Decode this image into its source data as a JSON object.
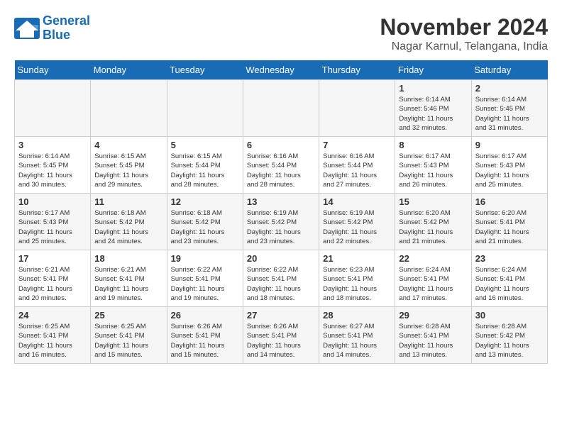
{
  "header": {
    "logo_line1": "General",
    "logo_line2": "Blue",
    "month": "November 2024",
    "location": "Nagar Karnul, Telangana, India"
  },
  "weekdays": [
    "Sunday",
    "Monday",
    "Tuesday",
    "Wednesday",
    "Thursday",
    "Friday",
    "Saturday"
  ],
  "weeks": [
    [
      {
        "day": "",
        "info": ""
      },
      {
        "day": "",
        "info": ""
      },
      {
        "day": "",
        "info": ""
      },
      {
        "day": "",
        "info": ""
      },
      {
        "day": "",
        "info": ""
      },
      {
        "day": "1",
        "info": "Sunrise: 6:14 AM\nSunset: 5:46 PM\nDaylight: 11 hours\nand 32 minutes."
      },
      {
        "day": "2",
        "info": "Sunrise: 6:14 AM\nSunset: 5:45 PM\nDaylight: 11 hours\nand 31 minutes."
      }
    ],
    [
      {
        "day": "3",
        "info": "Sunrise: 6:14 AM\nSunset: 5:45 PM\nDaylight: 11 hours\nand 30 minutes."
      },
      {
        "day": "4",
        "info": "Sunrise: 6:15 AM\nSunset: 5:45 PM\nDaylight: 11 hours\nand 29 minutes."
      },
      {
        "day": "5",
        "info": "Sunrise: 6:15 AM\nSunset: 5:44 PM\nDaylight: 11 hours\nand 28 minutes."
      },
      {
        "day": "6",
        "info": "Sunrise: 6:16 AM\nSunset: 5:44 PM\nDaylight: 11 hours\nand 28 minutes."
      },
      {
        "day": "7",
        "info": "Sunrise: 6:16 AM\nSunset: 5:44 PM\nDaylight: 11 hours\nand 27 minutes."
      },
      {
        "day": "8",
        "info": "Sunrise: 6:17 AM\nSunset: 5:43 PM\nDaylight: 11 hours\nand 26 minutes."
      },
      {
        "day": "9",
        "info": "Sunrise: 6:17 AM\nSunset: 5:43 PM\nDaylight: 11 hours\nand 25 minutes."
      }
    ],
    [
      {
        "day": "10",
        "info": "Sunrise: 6:17 AM\nSunset: 5:43 PM\nDaylight: 11 hours\nand 25 minutes."
      },
      {
        "day": "11",
        "info": "Sunrise: 6:18 AM\nSunset: 5:42 PM\nDaylight: 11 hours\nand 24 minutes."
      },
      {
        "day": "12",
        "info": "Sunrise: 6:18 AM\nSunset: 5:42 PM\nDaylight: 11 hours\nand 23 minutes."
      },
      {
        "day": "13",
        "info": "Sunrise: 6:19 AM\nSunset: 5:42 PM\nDaylight: 11 hours\nand 23 minutes."
      },
      {
        "day": "14",
        "info": "Sunrise: 6:19 AM\nSunset: 5:42 PM\nDaylight: 11 hours\nand 22 minutes."
      },
      {
        "day": "15",
        "info": "Sunrise: 6:20 AM\nSunset: 5:42 PM\nDaylight: 11 hours\nand 21 minutes."
      },
      {
        "day": "16",
        "info": "Sunrise: 6:20 AM\nSunset: 5:41 PM\nDaylight: 11 hours\nand 21 minutes."
      }
    ],
    [
      {
        "day": "17",
        "info": "Sunrise: 6:21 AM\nSunset: 5:41 PM\nDaylight: 11 hours\nand 20 minutes."
      },
      {
        "day": "18",
        "info": "Sunrise: 6:21 AM\nSunset: 5:41 PM\nDaylight: 11 hours\nand 19 minutes."
      },
      {
        "day": "19",
        "info": "Sunrise: 6:22 AM\nSunset: 5:41 PM\nDaylight: 11 hours\nand 19 minutes."
      },
      {
        "day": "20",
        "info": "Sunrise: 6:22 AM\nSunset: 5:41 PM\nDaylight: 11 hours\nand 18 minutes."
      },
      {
        "day": "21",
        "info": "Sunrise: 6:23 AM\nSunset: 5:41 PM\nDaylight: 11 hours\nand 18 minutes."
      },
      {
        "day": "22",
        "info": "Sunrise: 6:24 AM\nSunset: 5:41 PM\nDaylight: 11 hours\nand 17 minutes."
      },
      {
        "day": "23",
        "info": "Sunrise: 6:24 AM\nSunset: 5:41 PM\nDaylight: 11 hours\nand 16 minutes."
      }
    ],
    [
      {
        "day": "24",
        "info": "Sunrise: 6:25 AM\nSunset: 5:41 PM\nDaylight: 11 hours\nand 16 minutes."
      },
      {
        "day": "25",
        "info": "Sunrise: 6:25 AM\nSunset: 5:41 PM\nDaylight: 11 hours\nand 15 minutes."
      },
      {
        "day": "26",
        "info": "Sunrise: 6:26 AM\nSunset: 5:41 PM\nDaylight: 11 hours\nand 15 minutes."
      },
      {
        "day": "27",
        "info": "Sunrise: 6:26 AM\nSunset: 5:41 PM\nDaylight: 11 hours\nand 14 minutes."
      },
      {
        "day": "28",
        "info": "Sunrise: 6:27 AM\nSunset: 5:41 PM\nDaylight: 11 hours\nand 14 minutes."
      },
      {
        "day": "29",
        "info": "Sunrise: 6:28 AM\nSunset: 5:41 PM\nDaylight: 11 hours\nand 13 minutes."
      },
      {
        "day": "30",
        "info": "Sunrise: 6:28 AM\nSunset: 5:42 PM\nDaylight: 11 hours\nand 13 minutes."
      }
    ]
  ]
}
